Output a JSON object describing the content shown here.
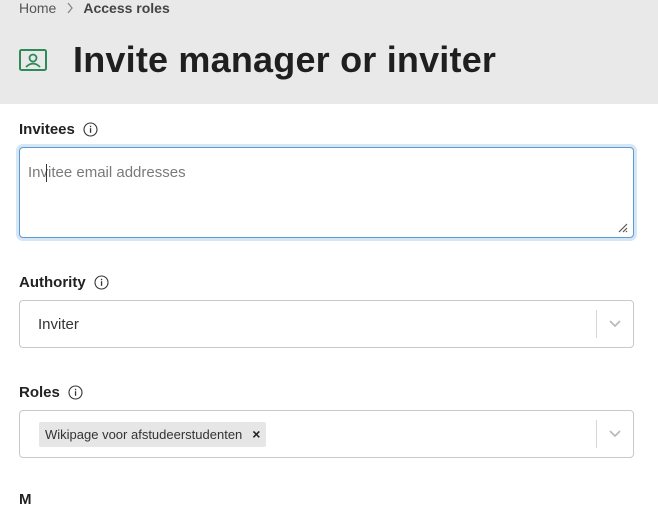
{
  "breadcrumb": {
    "home": "Home",
    "current": "Access roles"
  },
  "page": {
    "title": "Invite manager or inviter"
  },
  "invitees": {
    "label": "Invitees",
    "placeholder": "Invitee email addresses",
    "value": ""
  },
  "authority": {
    "label": "Authority",
    "selected": "Inviter"
  },
  "roles": {
    "label": "Roles",
    "selected_chips": [
      "Wikipage voor afstudeerstudenten"
    ],
    "remove_glyph": "×"
  },
  "next_section": {
    "label": "M"
  },
  "icons": {
    "breadcrumb_separator": "chevron-right-icon",
    "title": "id-card-icon",
    "info": "info-circle-icon",
    "dropdown": "chevron-down-icon",
    "resize": "resize-handle-icon"
  },
  "colors": {
    "header_bg": "#e9e9ea",
    "title_icon": "#2e8b57",
    "focus_border": "#5b9bd5",
    "chip_bg": "#e6e6e6"
  }
}
